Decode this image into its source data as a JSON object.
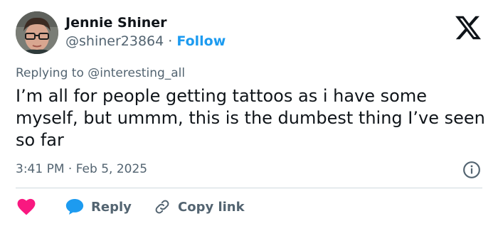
{
  "author": {
    "name": "Jennie Shiner",
    "handle": "@shiner23864",
    "separator": "·",
    "follow_label": "Follow"
  },
  "replying": {
    "prefix": "Replying to ",
    "mention": "@interesting_all"
  },
  "tweet": {
    "text": "I’m all for people getting tattoos as i have some myself, but ummm, this is the dumbest thing I’ve seen so far",
    "timestamp": "3:41 PM · Feb 5, 2025"
  },
  "actions": {
    "reply_label": "Reply",
    "copy_link_label": "Copy link"
  },
  "colors": {
    "like": "#f91880",
    "reply": "#1d9bf0",
    "follow": "#1d9bf0",
    "muted": "#536471"
  },
  "icons": [
    "x-logo-icon",
    "info-icon",
    "heart-icon",
    "speech-bubble-icon",
    "link-icon"
  ]
}
